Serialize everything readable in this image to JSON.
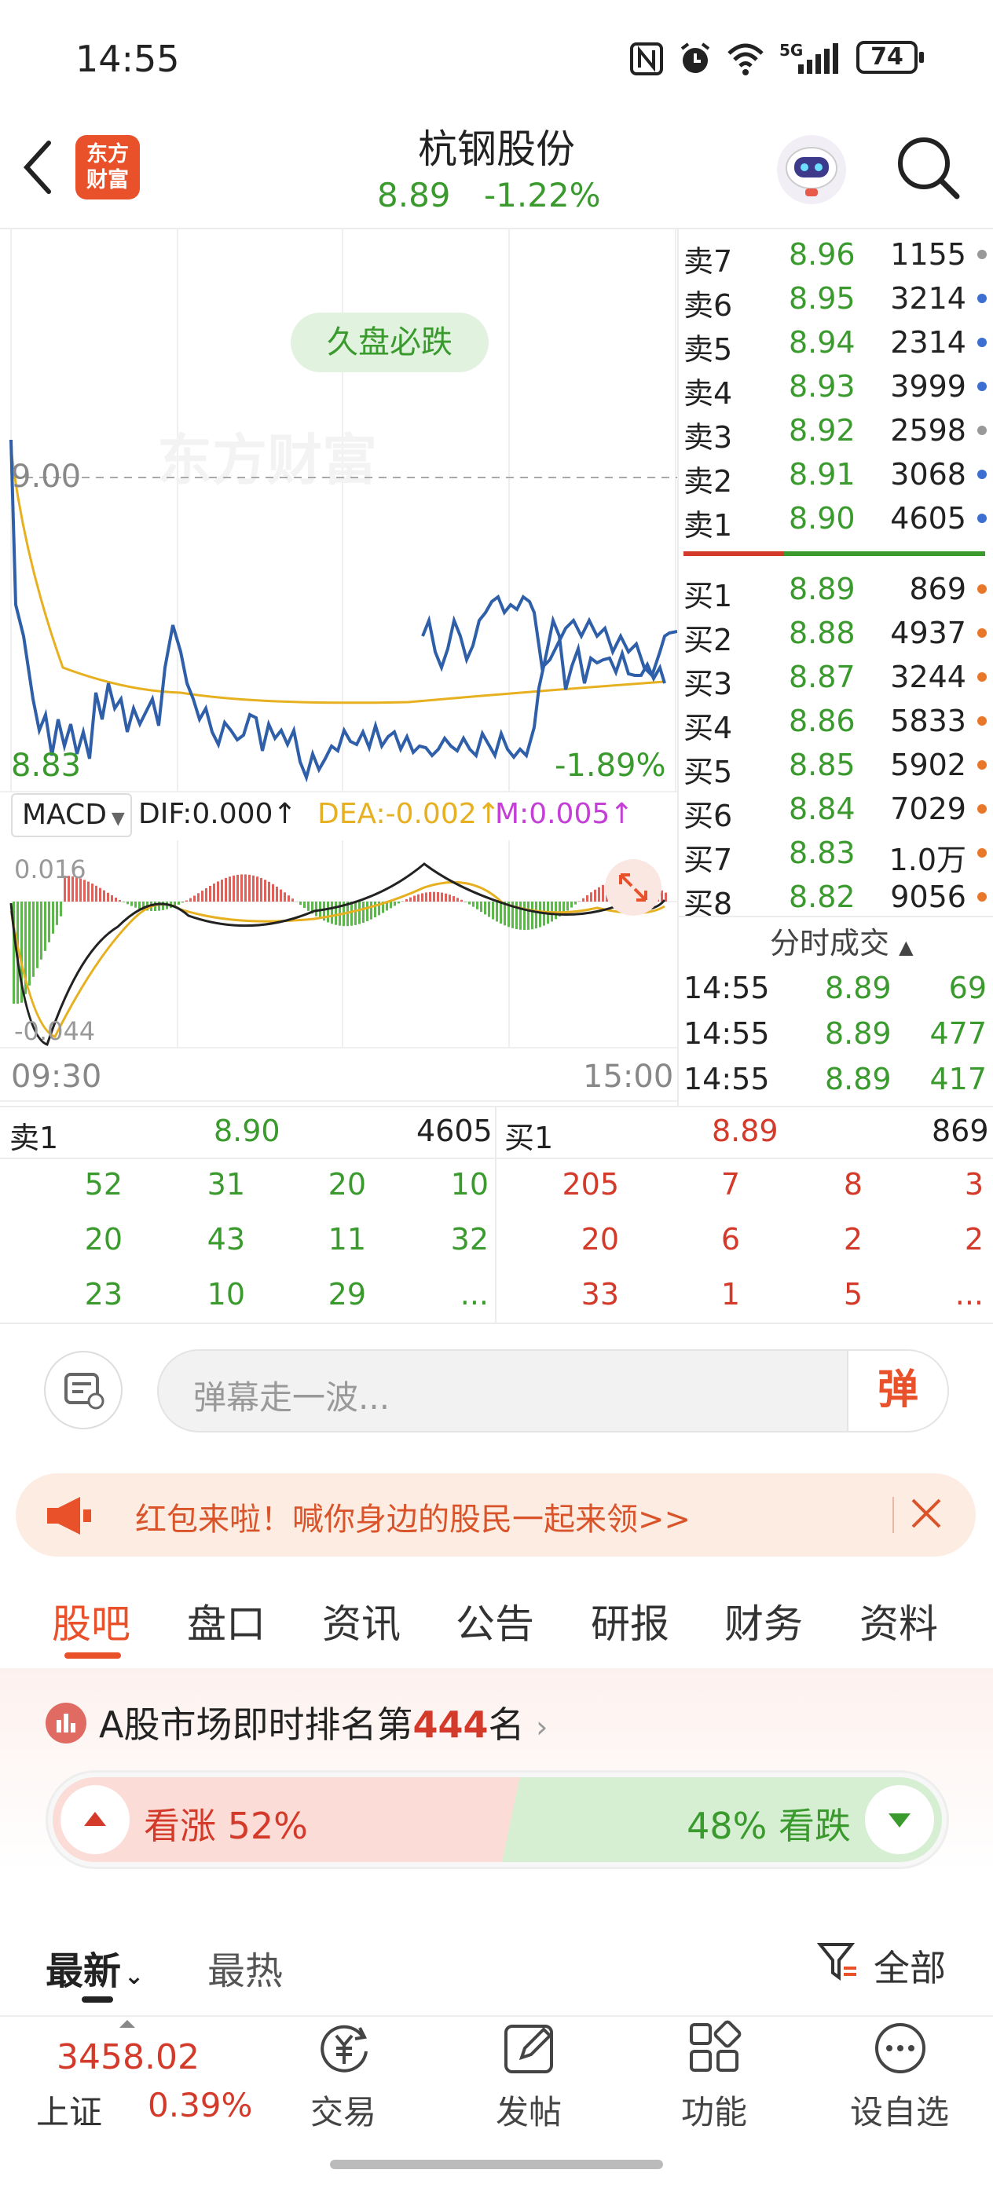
{
  "status_bar": {
    "time": "14:55",
    "battery": "74",
    "network": "5G"
  },
  "header": {
    "logo_line1": "东方",
    "logo_line2": "财富",
    "stock_name": "杭钢股份",
    "price": "8.89",
    "change_pct": "-1.22%"
  },
  "chart": {
    "tag": "久盘必跌",
    "watermark": "东方财富",
    "ref_price_label": "9.00",
    "low_price_label": "8.83",
    "low_pct_label": "-1.89%",
    "time_start": "09:30",
    "time_end": "15:00",
    "macd": {
      "select": "MACD",
      "dif": "DIF:0.000",
      "dea": "DEA:-0.002",
      "m": "M:0.005",
      "top_label": "0.016",
      "bottom_label": "-0.044"
    }
  },
  "order_book": {
    "asks": [
      {
        "label": "卖7",
        "price": "8.96",
        "vol": "1155",
        "dot": "#999999"
      },
      {
        "label": "卖6",
        "price": "8.95",
        "vol": "3214",
        "dot": "#3b6fd1"
      },
      {
        "label": "卖5",
        "price": "8.94",
        "vol": "2314",
        "dot": "#3b6fd1"
      },
      {
        "label": "卖4",
        "price": "8.93",
        "vol": "3999",
        "dot": "#3b6fd1"
      },
      {
        "label": "卖3",
        "price": "8.92",
        "vol": "2598",
        "dot": "#999999"
      },
      {
        "label": "卖2",
        "price": "8.91",
        "vol": "3068",
        "dot": "#3b6fd1"
      },
      {
        "label": "卖1",
        "price": "8.90",
        "vol": "4605",
        "dot": "#3b6fd1"
      }
    ],
    "bids": [
      {
        "label": "买1",
        "price": "8.89",
        "vol": "869",
        "dot": "#e8772a"
      },
      {
        "label": "买2",
        "price": "8.88",
        "vol": "4937",
        "dot": "#e8772a"
      },
      {
        "label": "买3",
        "price": "8.87",
        "vol": "3244",
        "dot": "#e8772a"
      },
      {
        "label": "买4",
        "price": "8.86",
        "vol": "5833",
        "dot": "#e8772a"
      },
      {
        "label": "买5",
        "price": "8.85",
        "vol": "5902",
        "dot": "#e8772a"
      },
      {
        "label": "买6",
        "price": "8.84",
        "vol": "7029",
        "dot": "#e8772a"
      },
      {
        "label": "买7",
        "price": "8.83",
        "vol": "1.0万",
        "dot": "#e8772a"
      },
      {
        "label": "买8",
        "price": "8.82",
        "vol": "9056",
        "dot": "#e8772a"
      }
    ],
    "trades_title": "分时成交",
    "trades": [
      {
        "time": "14:55",
        "price": "8.89",
        "vol": "69"
      },
      {
        "time": "14:55",
        "price": "8.89",
        "vol": "477"
      },
      {
        "time": "14:55",
        "price": "8.89",
        "vol": "417"
      }
    ]
  },
  "queue": {
    "sell_label": "卖1",
    "sell_price": "8.90",
    "sell_vol": "4605",
    "buy_label": "买1",
    "buy_price": "8.89",
    "buy_vol": "869",
    "sell_rows": [
      [
        "52",
        "31",
        "20",
        "10"
      ],
      [
        "20",
        "43",
        "11",
        "32"
      ],
      [
        "23",
        "10",
        "29",
        "..."
      ]
    ],
    "buy_rows": [
      [
        "205",
        "7",
        "8",
        "3"
      ],
      [
        "20",
        "6",
        "2",
        "2"
      ],
      [
        "33",
        "1",
        "5",
        "..."
      ]
    ]
  },
  "danmaku": {
    "placeholder": "弹幕走一波...",
    "button": "弹"
  },
  "banner": {
    "text": "红包来啦！喊你身边的股民一起来领>>"
  },
  "tabs": [
    "股吧",
    "盘口",
    "资讯",
    "公告",
    "研报",
    "财务",
    "资料"
  ],
  "rank": {
    "prefix": "A股市场即时排名第",
    "number": "444",
    "suffix": "名"
  },
  "sentiment": {
    "bull": "看涨 52%",
    "bear": "48% 看跌"
  },
  "sort": {
    "latest": "最新",
    "hot": "最热",
    "filter": "全部"
  },
  "bottom_nav": {
    "index_value": "3458.02",
    "index_name": "上证",
    "index_pct": "0.39%",
    "items": [
      "交易",
      "发帖",
      "功能",
      "设自选"
    ]
  },
  "colors": {
    "accent": "#e8512a",
    "up": "#d43a2a",
    "down": "#3a9a2e",
    "price_line": "#2f5fa8",
    "avg_line": "#e6b020"
  }
}
